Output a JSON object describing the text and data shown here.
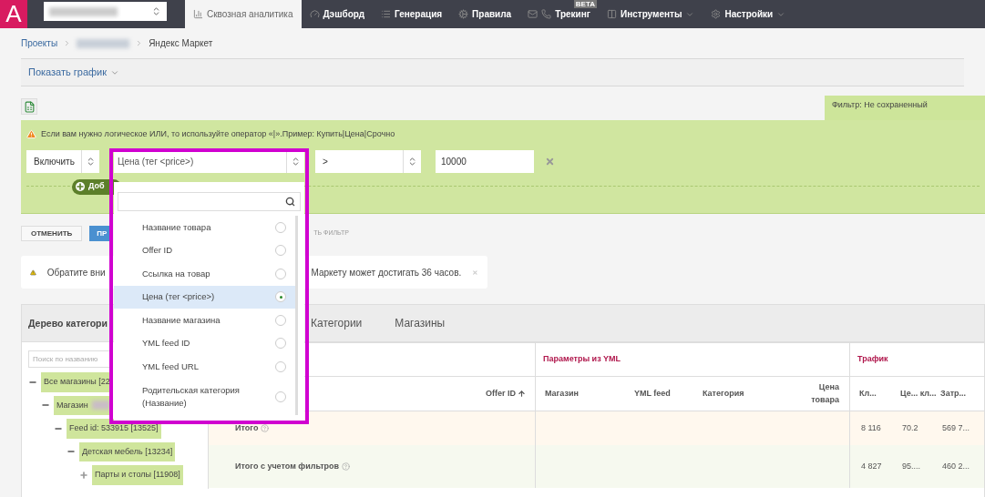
{
  "logo": "A",
  "nav": {
    "tabs": [
      {
        "label": "Сквозная аналитика",
        "selected": true,
        "has_menu": false
      },
      {
        "label": "Дэшборд",
        "selected": false,
        "has_menu": false
      },
      {
        "label": "Генерация",
        "selected": false,
        "has_menu": false
      },
      {
        "label": "Правила",
        "selected": false,
        "has_menu": false
      },
      {
        "label": "Трекинг",
        "selected": false,
        "has_menu": false,
        "badge": "BETA"
      },
      {
        "label": "Инструменты",
        "selected": false,
        "has_menu": true
      },
      {
        "label": "Настройки",
        "selected": false,
        "has_menu": true
      }
    ]
  },
  "breadcrumbs": [
    {
      "label": "Проекты",
      "link": true
    },
    {
      "label": "Яндекс Маркет",
      "link": false
    }
  ],
  "chart_toggle": "Показать график",
  "filter": {
    "tab": "Фильтр: Не сохраненный",
    "hint": "Если вам нужно логическое ИЛИ, то используйте оператор «|».Пример: Купить|Цена|Срочно",
    "mode": "Включить",
    "field": "Цена (тег <price>)",
    "operator": ">",
    "value": "10000",
    "add_button": "Доб",
    "dropdown": {
      "open": true,
      "options": [
        {
          "label": "Название товара",
          "selected": false
        },
        {
          "label": "Offer ID",
          "selected": false
        },
        {
          "label": "Ссылка на товар",
          "selected": false
        },
        {
          "label": "Цена (тег <price>)",
          "selected": true
        },
        {
          "label": "Название магазина",
          "selected": false
        },
        {
          "label": "YML feed ID",
          "selected": false
        },
        {
          "label": "YML feed URL",
          "selected": false
        },
        {
          "label": "Родительская категория (Название)",
          "selected": false
        }
      ]
    }
  },
  "actions": {
    "cancel": "ОТМЕНИТЬ",
    "apply": "ПР",
    "save": "ТЬ ФИЛЬТР"
  },
  "notice": {
    "left": "Обратите вни",
    "right": "Маркету может достигать 36 часов."
  },
  "panel": {
    "tree_title": "Дерево категори",
    "tabs": [
      {
        "label": "Категории",
        "selected": false
      },
      {
        "label": "Магазины",
        "selected": false
      }
    ],
    "tree_search": {
      "placeholder": "Поиск по названию"
    },
    "tree": [
      {
        "label": "Все магазины [22",
        "expanded": true,
        "children": [
          {
            "label": "Магазин",
            "blurred": true,
            "expanded": true,
            "children": [
              {
                "label": "Feed id: 533915 [13525]",
                "expanded": true,
                "children": [
                  {
                    "label": "Детская мебель [13234]",
                    "expanded": true,
                    "children": [
                      {
                        "label": "Парты и столы [11908]",
                        "expanded": false
                      }
                    ]
                  }
                ]
              }
            ]
          }
        ]
      }
    ],
    "table": {
      "groups": [
        {
          "label": "Параметры из YML"
        },
        {
          "label": "Трафик"
        }
      ],
      "columns": [
        {
          "label": "Offer ID",
          "sorted": true
        },
        {
          "label": "Магазин"
        },
        {
          "label": "YML feed"
        },
        {
          "label": "Категория"
        },
        {
          "label": "Цена товара"
        },
        {
          "label": "Кл..."
        },
        {
          "label": "Це... кл..."
        },
        {
          "label": "Затр..."
        }
      ],
      "rows": [
        {
          "kind": "total",
          "label": "Итого",
          "values": [
            "8 116",
            "70.2",
            "569 7..."
          ]
        },
        {
          "kind": "filtered",
          "label": "Итого с учетом фильтров",
          "values": [
            "4 827",
            "95....",
            "460 2..."
          ]
        }
      ]
    }
  }
}
